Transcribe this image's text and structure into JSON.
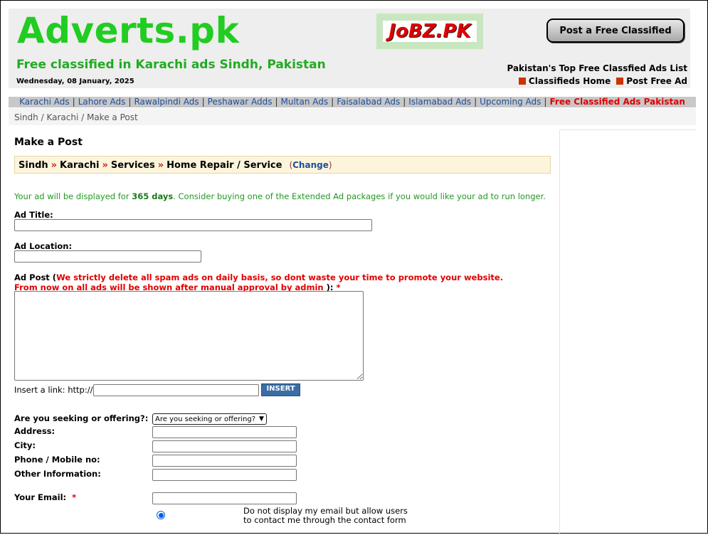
{
  "header": {
    "logo": "Adverts.pk",
    "tagline": "Free classified in Karachi ads Sindh, Pakistan",
    "date": "Wednesday, 08 January, 2025",
    "banner_text": "JoBZ.PK",
    "post_button": "Post a Free Classified",
    "top_list": "Pakistan's Top Free Classfied Ads List",
    "links": [
      "Classifieds Home",
      "Post Free Ad"
    ]
  },
  "nav": {
    "items": [
      "Karachi Ads",
      "Lahore Ads",
      "Rawalpindi Ads",
      "Peshawar Adds",
      "Multan Ads",
      "Faisalabad Ads",
      "Islamabad Ads",
      "Upcoming Ads"
    ],
    "highlight": "Free Classified Ads Pakistan"
  },
  "breadcrumb": [
    "Sindh",
    "Karachi",
    "Make a Post"
  ],
  "form": {
    "title": "Make a Post",
    "category": [
      "Sindh",
      "Karachi",
      "Services",
      "Home Repair / Service"
    ],
    "change_label": "Change",
    "notice_pre": "Your ad will be displayed for",
    "notice_days": "365 days",
    "notice_post": ". Consider buying one of the Extended Ad packages if you would like your ad to run longer.",
    "ad_title_label": "Ad Title:",
    "ad_location_label": "Ad Location:",
    "ad_post_label": "Ad Post (",
    "warn_line1": "We strictly delete all spam ads on daily basis, so dont waste your time to promote your website.",
    "warn_line2": "From now on all ads will be shown after manual approval by admin",
    "warn_close": " ):",
    "required_mark": "*",
    "insert_link_label": "Insert a link: http://",
    "insert_button": "INSERT",
    "seeking_label": "Are you seeking or offering?:",
    "seeking_selected": "Are you seeking or offering?",
    "address_label": "Address:",
    "city_label": "City:",
    "phone_label": "Phone / Mobile no:",
    "other_label": "Other Information:",
    "email_label": "Your Email:",
    "hide_email_line1": "Do not display my email but allow users",
    "hide_email_line2": "to contact me through the contact form"
  },
  "colors": {
    "logo": "#22cc22",
    "required": "#e00000",
    "link": "#1f4e99"
  }
}
